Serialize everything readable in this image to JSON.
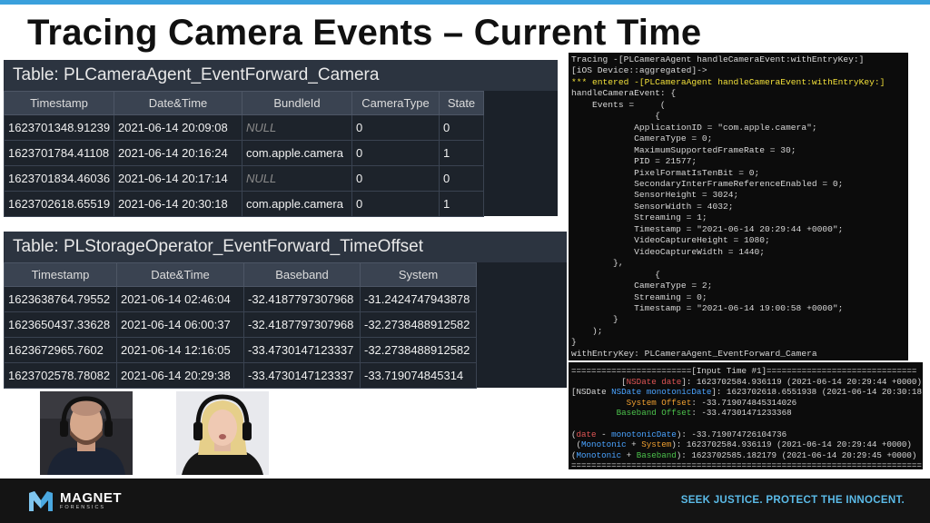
{
  "slide": {
    "title": "Tracing Camera Events – Current Time"
  },
  "table1": {
    "title": "Table: PLCameraAgent_EventForward_Camera",
    "columns": [
      "Timestamp",
      "Date&Time",
      "BundleId",
      "CameraType",
      "State"
    ],
    "rows": [
      [
        "1623701348.91239",
        "2021-06-14 20:09:08",
        "NULL",
        "0",
        "0"
      ],
      [
        "1623701784.41108",
        "2021-06-14 20:16:24",
        "com.apple.camera",
        "0",
        "1"
      ],
      [
        "1623701834.46036",
        "2021-06-14 20:17:14",
        "NULL",
        "0",
        "0"
      ],
      [
        "1623702618.65519",
        "2021-06-14 20:30:18",
        "com.apple.camera",
        "0",
        "1"
      ]
    ]
  },
  "table2": {
    "title": "Table: PLStorageOperator_EventForward_TimeOffset",
    "columns": [
      "Timestamp",
      "Date&Time",
      "Baseband",
      "System"
    ],
    "rows": [
      [
        "1623638764.79552",
        "2021-06-14 02:46:04",
        "-32.4187797307968",
        "-31.2424747943878"
      ],
      [
        "1623650437.33628",
        "2021-06-14 06:00:37",
        "-32.4187797307968",
        "-32.2738488912582"
      ],
      [
        "1623672965.7602",
        "2021-06-14 12:16:05",
        "-33.4730147123337",
        "-32.2738488912582"
      ],
      [
        "1623702578.78082",
        "2021-06-14 20:29:38",
        "-33.4730147123337",
        "-33.719074845314"
      ]
    ]
  },
  "console": {
    "line1": "Tracing -[PLCameraAgent handleCameraEvent:withEntryKey:]",
    "line2": "[iOS Device::aggregated]->",
    "line3": "*** entered -[PLCameraAgent handleCameraEvent:withEntryKey:]",
    "line4": "handleCameraEvent: {",
    "body": "    Events =     (\n                {\n            ApplicationID = \"com.apple.camera\";\n            CameraType = 0;\n            MaximumSupportedFrameRate = 30;\n            PID = 21577;\n            PixelFormatIsTenBit = 0;\n            SecondaryInterFrameReferenceEnabled = 0;\n            SensorHeight = 3024;\n            SensorWidth = 4032;\n            Streaming = 1;\n            Timestamp = \"2021-06-14 20:29:44 +0000\";\n            VideoCaptureHeight = 1080;\n            VideoCaptureWidth = 1440;\n        },\n                {\n            CameraType = 2;\n            Streaming = 0;\n            Timestamp = \"2021-06-14 19:00:58 +0000\";\n        }\n    );\n}",
    "line_last": "withEntryKey: PLCameraAgent_EventForward_Camera"
  },
  "time_output": {
    "header": "========================[Input Time #1]==============================",
    "nsdate_label": "NSDate date",
    "nsdate_value": ": 1623702584.936119 (2021-06-14 20:29:44 +0000)",
    "monotonic_label": "NSDate monotonicDate",
    "monotonic_value": ": 1623702618.6551938 (2021-06-14 20:30:18 +0000)",
    "sys_label": "System Offset",
    "sys_value": ": -33.719074845314026",
    "bb_label": "Baseband Offset",
    "bb_value": ": -33.47301471233368",
    "diff_a": "date",
    "diff_b": "monotonicDate",
    "diff_value": "): -33.719074726104736",
    "mono_sys_a": "Monotonic",
    "mono_sys_b": "System",
    "mono_sys_value": "): 1623702584.936119 (2021-06-14 20:29:44 +0000)",
    "mono_bb_a": "Monotonic",
    "mono_bb_b": "Baseband",
    "mono_bb_value": "): 1623702585.182179 (2021-06-14 20:29:45 +0000)",
    "footer": "======================================================================"
  },
  "footer": {
    "logo_main": "MAGNET",
    "logo_sub": "FORENSICS",
    "tagline": "SEEK JUSTICE. PROTECT THE INNOCENT."
  },
  "colors": {
    "accent_blue": "#3aa0dc",
    "tagline": "#5bbbe8",
    "console_highlight": "#f2e03a"
  }
}
